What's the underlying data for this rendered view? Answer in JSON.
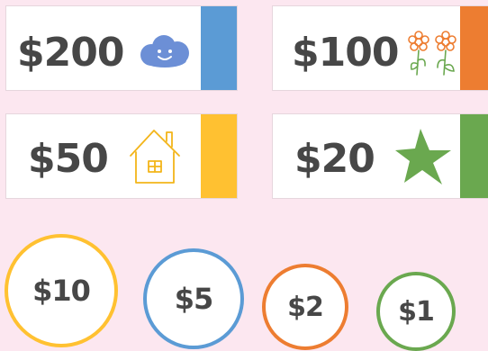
{
  "background_color": "#fce7f0",
  "bills": [
    {
      "label": "$200",
      "icon": "cloud-icon",
      "color": "#5b9bd5"
    },
    {
      "label": "$100",
      "icon": "flowers-icon",
      "color": "#ed7d31"
    },
    {
      "label": "$50",
      "icon": "house-icon",
      "color": "#ffc131"
    },
    {
      "label": "$20",
      "icon": "star-icon",
      "color": "#6aa84f"
    }
  ],
  "coins": [
    {
      "label": "$10",
      "color": "#ffc131"
    },
    {
      "label": "$5",
      "color": "#5b9bd5"
    },
    {
      "label": "$2",
      "color": "#ed7d31"
    },
    {
      "label": "$1",
      "color": "#6aa84f"
    }
  ]
}
